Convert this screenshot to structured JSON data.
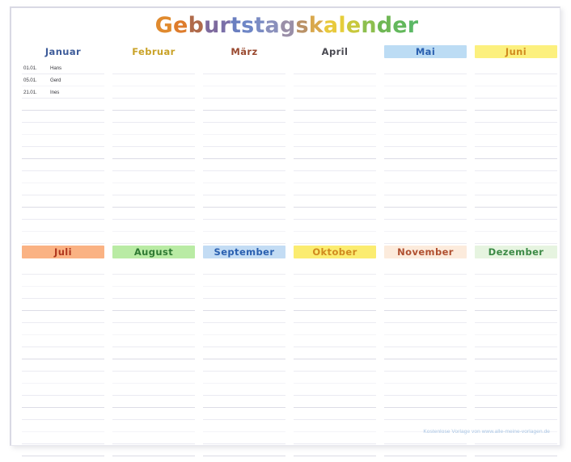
{
  "document": {
    "title_text": "Geburtstagskalender",
    "title_letters": [
      {
        "ch": "G",
        "color": "#E08A2E"
      },
      {
        "ch": "e",
        "color": "#DE7C2C"
      },
      {
        "ch": "b",
        "color": "#B06A4A"
      },
      {
        "ch": "u",
        "color": "#7E6A9E"
      },
      {
        "ch": "r",
        "color": "#7A6FA8"
      },
      {
        "ch": "t",
        "color": "#6B7FC0"
      },
      {
        "ch": "s",
        "color": "#6E86C6"
      },
      {
        "ch": "t",
        "color": "#7B8CC4"
      },
      {
        "ch": "a",
        "color": "#8A90BC"
      },
      {
        "ch": "g",
        "color": "#9A8FA8"
      },
      {
        "ch": "s",
        "color": "#B99166"
      },
      {
        "ch": "k",
        "color": "#D9A84C"
      },
      {
        "ch": "a",
        "color": "#E8C93C"
      },
      {
        "ch": "l",
        "color": "#E6CE3A"
      },
      {
        "ch": "e",
        "color": "#C8C83C"
      },
      {
        "ch": "n",
        "color": "#8DBF4E"
      },
      {
        "ch": "d",
        "color": "#6FB754"
      },
      {
        "ch": "e",
        "color": "#63B85C"
      },
      {
        "ch": "r",
        "color": "#5CB866"
      }
    ]
  },
  "footer": {
    "credit": "Kostenlose Vorlage von www.alle-meine-vorlagen.de",
    "color": "#a9c5e4"
  },
  "calendar": {
    "rows_per_month": 16,
    "months": [
      {
        "name": "Januar",
        "text_color": "#3E5C9A",
        "bg_color": "transparent",
        "entries": [
          {
            "date": "01.01.",
            "name": "Hans"
          },
          {
            "date": "05.01.",
            "name": "Gerd"
          },
          {
            "date": "21.01.",
            "name": "Ines"
          }
        ]
      },
      {
        "name": "Februar",
        "text_color": "#C9A227",
        "bg_color": "transparent",
        "entries": []
      },
      {
        "name": "März",
        "text_color": "#9A4A30",
        "bg_color": "transparent",
        "entries": []
      },
      {
        "name": "April",
        "text_color": "#4A4A52",
        "bg_color": "transparent",
        "entries": []
      },
      {
        "name": "Mai",
        "text_color": "#2A60B0",
        "bg_color": "#BCDCF4",
        "entries": []
      },
      {
        "name": "Juni",
        "text_color": "#D08A1E",
        "bg_color": "#FCF07E",
        "entries": []
      },
      {
        "name": "Juli",
        "text_color": "#B0361E",
        "bg_color": "#FAB283",
        "entries": []
      },
      {
        "name": "August",
        "text_color": "#2F7A33",
        "bg_color": "#B9EBA4",
        "entries": []
      },
      {
        "name": "September",
        "text_color": "#2A60B0",
        "bg_color": "#C3DCF4",
        "entries": []
      },
      {
        "name": "Oktober",
        "text_color": "#D08A1E",
        "bg_color": "#FBEC70",
        "entries": []
      },
      {
        "name": "November",
        "text_color": "#B05030",
        "bg_color": "#FCEBDC",
        "entries": []
      },
      {
        "name": "Dezember",
        "text_color": "#3C8A46",
        "bg_color": "#E6F4E0",
        "entries": []
      }
    ]
  }
}
